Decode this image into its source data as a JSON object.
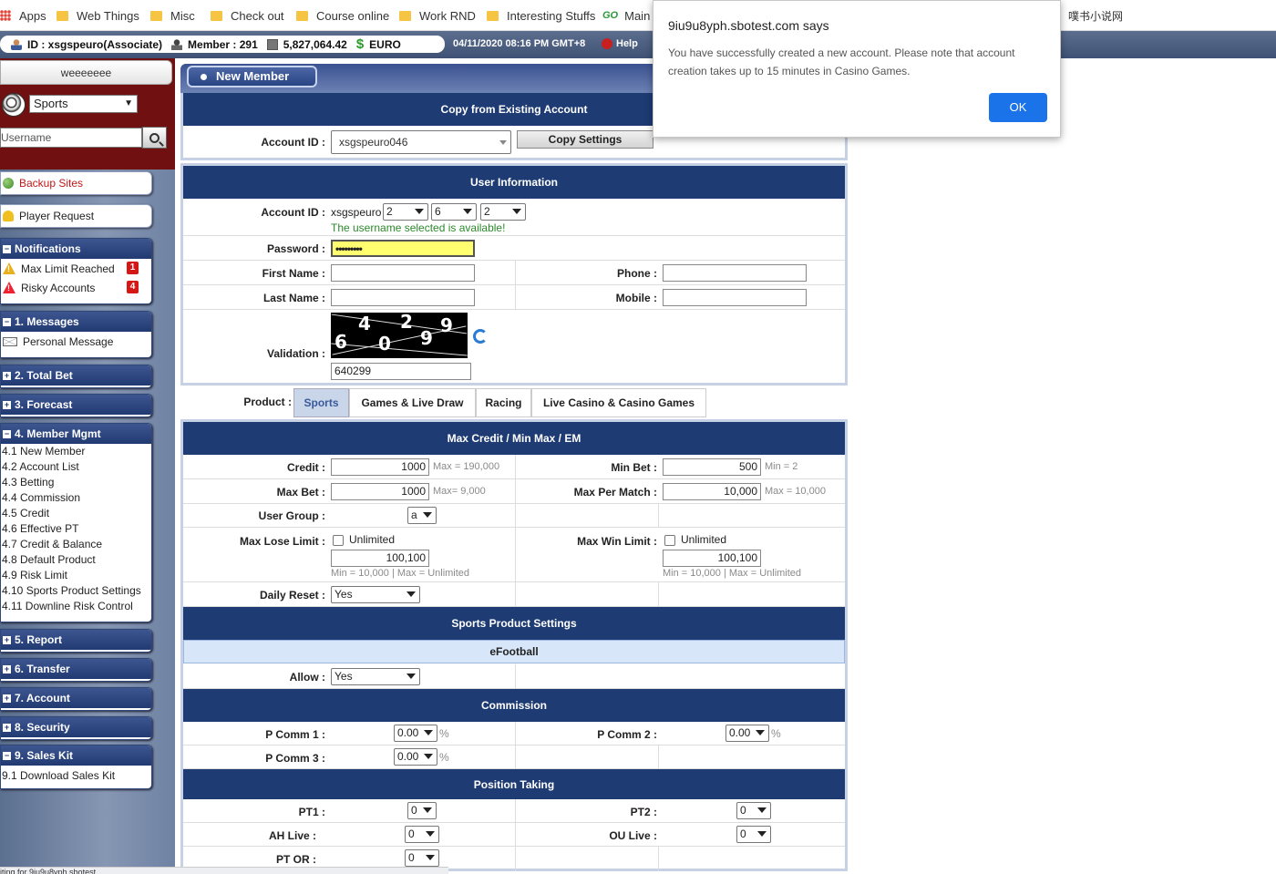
{
  "bookmarks": [
    {
      "label": "Apps",
      "icon": "apps-grid-icon"
    },
    {
      "label": "Web Things",
      "icon": "folder-icon"
    },
    {
      "label": "Misc",
      "icon": "folder-icon"
    },
    {
      "label": "Check out",
      "icon": "folder-icon"
    },
    {
      "label": "Course online",
      "icon": "folder-icon"
    },
    {
      "label": "Work RND",
      "icon": "folder-icon"
    },
    {
      "label": "Interesting Stuffs",
      "icon": "folder-icon"
    },
    {
      "label": "Main",
      "icon": "go-icon"
    },
    {
      "label": "噗书小说网",
      "icon": "none"
    }
  ],
  "infobar": {
    "id": "ID : xsgspeuro(Associate)",
    "member": "Member : 291",
    "balance": "5,827,064.42",
    "currency": "EURO",
    "datetime": "04/11/2020 08:16 PM GMT+8",
    "help": "Help"
  },
  "sidebar": {
    "top_name": "weeeeeee",
    "sport_select": "Sports",
    "username_placeholder": "Username",
    "backup_sites": "Backup Sites",
    "player_request": "Player Request",
    "notifications": {
      "title": "Notifications",
      "items": [
        {
          "label": "Max Limit Reached",
          "count": "1"
        },
        {
          "label": "Risky Accounts",
          "count": "4"
        }
      ]
    },
    "messages": {
      "title": "1. Messages",
      "items": [
        "Personal Message"
      ]
    },
    "total_bet": "2. Total Bet",
    "forecast": "3. Forecast",
    "member_mgmt": {
      "title": "4. Member Mgmt",
      "items": [
        "4.1 New Member",
        "4.2 Account List",
        "4.3 Betting",
        "4.4 Commission",
        "4.5 Credit",
        "4.6 Effective PT",
        "4.7 Credit & Balance",
        "4.8 Default Product",
        "4.9 Risk Limit",
        "4.10 Sports Product Settings",
        "4.11 Downline Risk Control"
      ]
    },
    "report": "5. Report",
    "transfer": "6. Transfer",
    "account": "7. Account",
    "security": "8. Security",
    "sales_kit": {
      "title": "9. Sales Kit",
      "items": [
        "9.1 Download Sales Kit"
      ]
    }
  },
  "main": {
    "tab_title": "New Member",
    "copy": {
      "header": "Copy from Existing Account",
      "account_label": "Account ID :",
      "account_value": "xsgspeuro046",
      "copy_button": "Copy Settings"
    },
    "user_info": {
      "header": "User Information",
      "account_label": "Account ID :",
      "account_prefix": "xsgspeuro",
      "sel1": "2",
      "sel2": "6",
      "sel3": "2",
      "available_msg": "The username selected is available!",
      "password_label": "Password :",
      "password_value": "•••••••••",
      "first_name_label": "First Name :",
      "last_name_label": "Last Name :",
      "phone_label": "Phone :",
      "mobile_label": "Mobile :",
      "validation_label": "Validation :",
      "captcha_text": "640299",
      "validation_value": "640299"
    },
    "product": {
      "label": "Product :",
      "tabs": [
        "Sports",
        "Games & Live Draw",
        "Racing",
        "Live Casino & Casino Games"
      ],
      "active": "Sports"
    },
    "credit": {
      "header": "Max Credit / Min Max / EM",
      "credit_label": "Credit :",
      "credit_value": "1000",
      "credit_hint": "Max = 190,000",
      "min_bet_label": "Min Bet :",
      "min_bet_value": "500",
      "min_bet_hint": "Min = 2",
      "max_bet_label": "Max Bet :",
      "max_bet_value": "1000",
      "max_bet_hint": "Max= 9,000",
      "max_per_match_label": "Max Per Match :",
      "max_per_match_value": "10,000",
      "max_per_match_hint": "Max = 10,000",
      "user_group_label": "User Group :",
      "user_group_value": "a",
      "max_lose_label": "Max Lose Limit :",
      "unlimited": "Unlimited",
      "max_lose_value": "100,100",
      "max_lose_hint": "Min = 10,000 | Max = Unlimited",
      "max_win_label": "Max Win Limit :",
      "max_win_value": "100,100",
      "max_win_hint": "Min = 10,000 | Max = Unlimited",
      "daily_reset_label": "Daily Reset :",
      "daily_reset_value": "Yes"
    },
    "sports_settings": {
      "header": "Sports Product Settings",
      "sub": "eFootball",
      "allow_label": "Allow :",
      "allow_value": "Yes"
    },
    "commission": {
      "header": "Commission",
      "p1_label": "P Comm 1 :",
      "p1_value": "0.00",
      "p2_label": "P Comm 2 :",
      "p2_value": "0.00",
      "p3_label": "P Comm 3 :",
      "p3_value": "0.00",
      "pct": "%"
    },
    "position": {
      "header": "Position Taking",
      "pt1_label": "PT1 :",
      "pt1_value": "0",
      "pt2_label": "PT2 :",
      "pt2_value": "0",
      "ah_label": "AH Live :",
      "ah_value": "0",
      "ou_label": "OU Live :",
      "ou_value": "0",
      "ptor_label": "PT OR :",
      "ptor_value": "0"
    }
  },
  "dialog": {
    "title": "9iu9u8yph.sbotest.com says",
    "message": "You have successfully created a new account. Please note that account creation takes up to 15 minutes in Casino Games.",
    "ok": "OK"
  },
  "status_bar": "iting for 9iu9u8yph.sbotest..."
}
